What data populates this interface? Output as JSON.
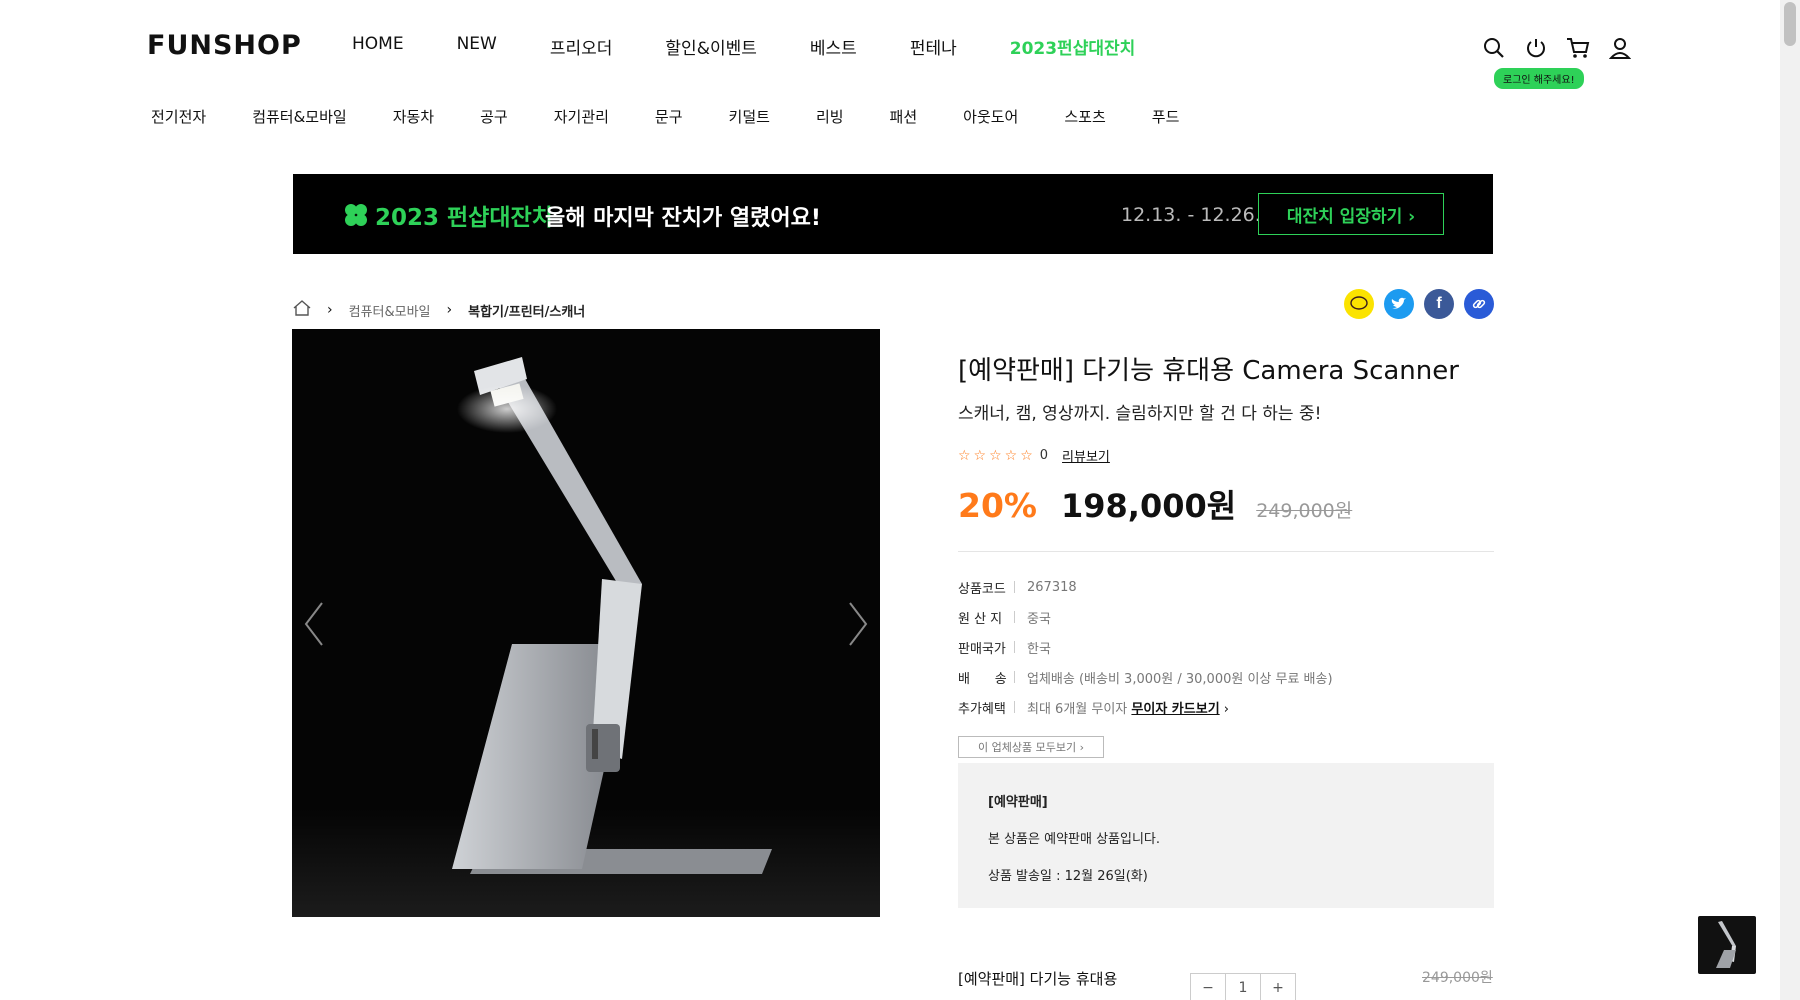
{
  "header": {
    "logo": "FUNSHOP",
    "nav": [
      "HOME",
      "NEW",
      "프리오더",
      "할인&이벤트",
      "베스트",
      "펀테나",
      "2023펀샵대잔치"
    ],
    "util_icons": [
      "search-icon",
      "power-icon",
      "cart-icon",
      "user-icon"
    ],
    "login_badge": "로그인 해주세요!"
  },
  "categories": [
    "전기전자",
    "컴퓨터&모바일",
    "자동차",
    "공구",
    "자기관리",
    "문구",
    "키덜트",
    "리빙",
    "패션",
    "아웃도어",
    "스포츠",
    "푸드"
  ],
  "banner": {
    "year_title": "2023 펀샵대잔치",
    "text": "올해 마지막 잔치가 열렸어요!",
    "date": "12.13. - 12.26.",
    "button": "대잔치 입장하기 ›"
  },
  "breadcrumb": {
    "home_icon": "home-icon",
    "items": [
      "컴퓨터&모바일",
      "복합기/프린터/스캐너"
    ]
  },
  "share_icons": [
    "kakaotalk-icon",
    "twitter-icon",
    "facebook-icon",
    "link-icon"
  ],
  "product": {
    "title": "[예약판매] 다기능 휴대용 Camera Scanner",
    "subtitle": "스캐너, 캠, 영상까지. 슬림하지만 할 건 다 하는 중!",
    "rating_stars": "☆☆☆☆☆",
    "review_count": "0",
    "review_link": "리뷰보기",
    "discount": "20%",
    "price": "198,000원",
    "original_price": "249,000원",
    "specs": [
      {
        "key": "상품코드",
        "value": "267318"
      },
      {
        "key": "원 산 지",
        "value": "중국"
      },
      {
        "key": "판매국가",
        "value": "한국"
      },
      {
        "key": "배      송",
        "value": "업체배송 (배송비 3,000원 / 30,000원 이상 무료 배송)"
      },
      {
        "key": "추가혜택",
        "value": "최대 6개월 무이자",
        "link": "무이자 카드보기"
      }
    ],
    "all_products_button": "이 업체상품 모두보기 ›",
    "colors": {
      "accent": "#2ed158",
      "discount": "#ff7a1a"
    }
  },
  "notice": {
    "title": "[예약판매]",
    "line1": "본 상품은 예약판매 상품입니다.",
    "line2": "상품 발송일 : 12월 26일(화)"
  },
  "option": {
    "name": "[예약판매] 다기능 휴대용",
    "minus": "−",
    "quantity": "1",
    "plus": "+",
    "old_price": "249,000원"
  }
}
